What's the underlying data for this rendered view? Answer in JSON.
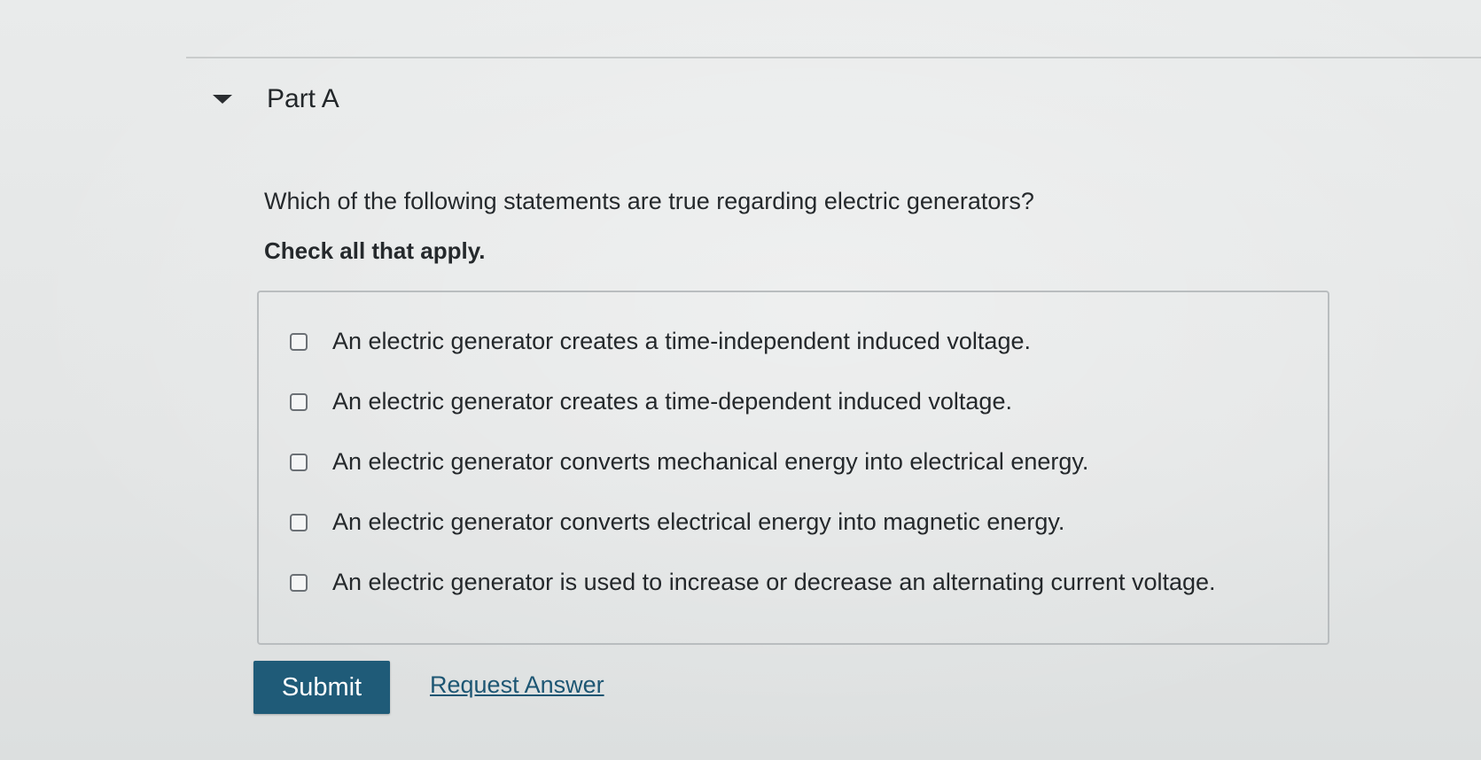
{
  "part": {
    "title": "Part A"
  },
  "question": {
    "text": "Which of the following statements are true regarding electric generators?",
    "instruction": "Check all that apply."
  },
  "options": [
    {
      "label": "An electric generator creates a time-independent induced voltage.",
      "checked": false
    },
    {
      "label": "An electric generator creates a time-dependent induced voltage.",
      "checked": false
    },
    {
      "label": "An electric generator converts mechanical energy into electrical energy.",
      "checked": false
    },
    {
      "label": "An electric generator converts electrical energy into magnetic energy.",
      "checked": false
    },
    {
      "label": "An electric generator is used to increase or decrease an alternating current voltage.",
      "checked": false
    }
  ],
  "actions": {
    "submit_label": "Submit",
    "request_answer_label": "Request Answer"
  },
  "colors": {
    "submit_background": "#1f5b78",
    "link": "#1d5673"
  }
}
